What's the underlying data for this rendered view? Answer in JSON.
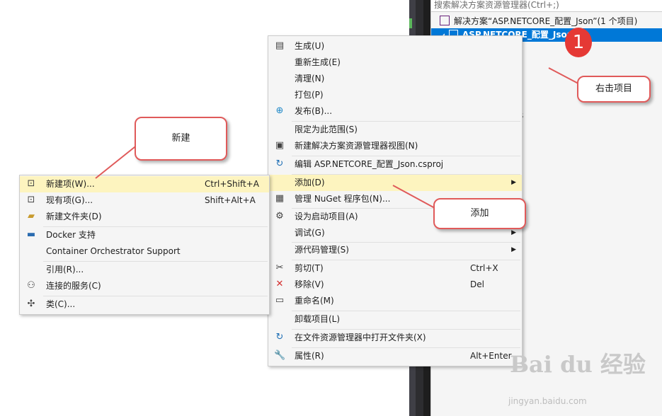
{
  "solution_explorer": {
    "search_placeholder": "搜索解决方案资源管理器(Ctrl+;)",
    "solution_label": "解决方案“ASP.NETCORE_配置_Json”(1 个项目)",
    "project_label": "ASP.NETCORE_配置_Json",
    "partial_text": "s"
  },
  "context_menu": {
    "items": [
      {
        "label": "生成(U)",
        "icon": "build-icon"
      },
      {
        "label": "重新生成(E)"
      },
      {
        "label": "清理(N)"
      },
      {
        "label": "打包(P)"
      },
      {
        "label": "发布(B)...",
        "icon": "globe-icon"
      },
      {
        "label": "限定为此范围(S)"
      },
      {
        "label": "新建解决方案资源管理器视图(N)",
        "icon": "new-view-icon"
      },
      {
        "label": "编辑 ASP.NETCORE_配置_Json.csproj",
        "icon": "refresh-icon"
      },
      {
        "label": "添加(D)",
        "submenu": true
      },
      {
        "label": "管理 NuGet 程序包(N)...",
        "icon": "nuget-icon"
      },
      {
        "label": "设为启动项目(A)",
        "icon": "gear-icon"
      },
      {
        "label": "调试(G)",
        "submenu": true
      },
      {
        "label": "源代码管理(S)",
        "submenu": true
      },
      {
        "label": "剪切(T)",
        "icon": "scissors-icon",
        "shortcut": "Ctrl+X"
      },
      {
        "label": "移除(V)",
        "icon": "remove-icon",
        "shortcut": "Del"
      },
      {
        "label": "重命名(M)",
        "icon": "rename-icon"
      },
      {
        "label": "卸载项目(L)"
      },
      {
        "label": "在文件资源管理器中打开文件夹(X)",
        "icon": "refresh-icon"
      },
      {
        "label": "属性(R)",
        "icon": "wrench-icon",
        "shortcut": "Alt+Enter"
      }
    ]
  },
  "add_submenu": {
    "items": [
      {
        "label": "新建项(W)...",
        "icon": "new-item-icon",
        "shortcut": "Ctrl+Shift+A"
      },
      {
        "label": "现有项(G)...",
        "icon": "existing-item-icon",
        "shortcut": "Shift+Alt+A"
      },
      {
        "label": "新建文件夹(D)",
        "icon": "new-folder-icon"
      },
      {
        "label": "Docker 支持",
        "icon": "docker-icon"
      },
      {
        "label": "Container Orchestrator Support"
      },
      {
        "label": "引用(R)..."
      },
      {
        "label": "连接的服务(C)",
        "icon": "connected-service-icon"
      },
      {
        "label": "类(C)...",
        "icon": "class-icon"
      }
    ]
  },
  "annotations": {
    "badge_number": "1",
    "right_click_callout": "右击项目",
    "add_callout": "添加",
    "new_callout": "新建",
    "accent_color": "#e05a5a"
  },
  "watermark": {
    "brand": "Bai du 经验",
    "url": "jingyan.baidu.com"
  }
}
